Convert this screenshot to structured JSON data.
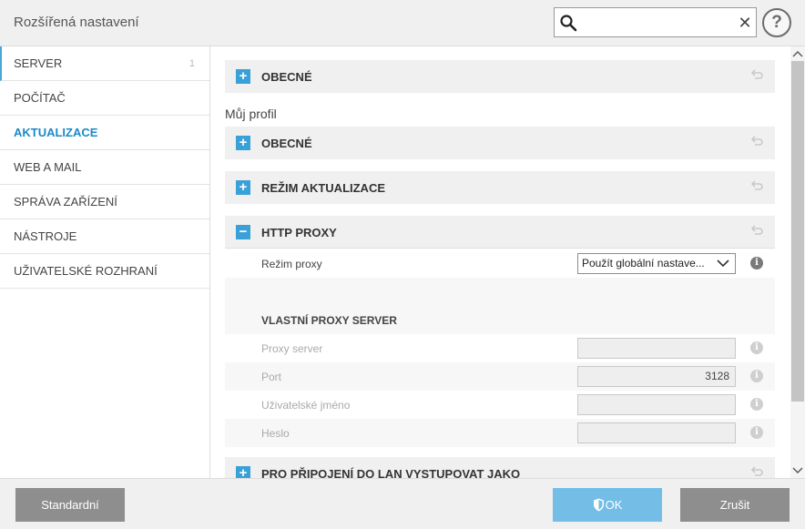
{
  "window": {
    "title": "Rozšířená nastavení"
  },
  "search": {
    "value": "",
    "placeholder": ""
  },
  "help": {
    "label": "?"
  },
  "sidebar": {
    "items": [
      {
        "label": "SERVER",
        "count": "1"
      },
      {
        "label": "POČÍTAČ"
      },
      {
        "label": "AKTUALIZACE"
      },
      {
        "label": "WEB A MAIL"
      },
      {
        "label": "SPRÁVA ZAŘÍZENÍ"
      },
      {
        "label": "NÁSTROJE"
      },
      {
        "label": "UŽIVATELSKÉ ROZHRANÍ"
      }
    ],
    "active_index": 2
  },
  "main": {
    "sections": {
      "general_top": {
        "label": "OBECNÉ",
        "toggle": "+"
      },
      "profile_label": "Můj profil",
      "general_profile": {
        "label": "OBECNÉ",
        "toggle": "+"
      },
      "update_mode": {
        "label": "REŽIM AKTUALIZACE",
        "toggle": "+"
      },
      "http_proxy": {
        "label": "HTTP PROXY",
        "toggle": "−"
      },
      "lan": {
        "label": "PRO PŘIPOJENÍ DO LAN VYSTUPOVAT JAKO",
        "toggle": "+"
      }
    },
    "proxy_mode": {
      "label": "Režim proxy",
      "value": "Použít globální nastave..."
    },
    "custom_proxy": {
      "heading": "VLASTNÍ PROXY SERVER",
      "server": {
        "label": "Proxy server",
        "value": ""
      },
      "port": {
        "label": "Port",
        "value": "3128"
      },
      "username": {
        "label": "Uživatelské jméno",
        "value": ""
      },
      "password": {
        "label": "Heslo",
        "value": ""
      }
    },
    "info_glyph": "i"
  },
  "footer": {
    "standard_label": "Standardní",
    "ok_label": "OK",
    "cancel_label": "Zrušit"
  },
  "colors": {
    "accent": "#3aa0d8",
    "active_nav": "#1a8ac7",
    "ok_button": "#73bde6",
    "neutral_button": "#8e8e8e"
  },
  "icons": [
    "search-icon",
    "clear-icon",
    "help-icon",
    "plus-icon",
    "minus-icon",
    "revert-icon",
    "info-icon",
    "chevron-down-icon",
    "shield-icon"
  ]
}
